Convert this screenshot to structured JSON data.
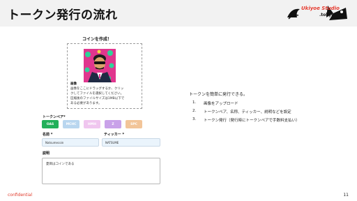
{
  "header": {
    "title": "トークン発行の流れ",
    "logo": {
      "brand": "Ukiyoe Studio",
      "sub": ".tokyo"
    }
  },
  "form": {
    "panel_title": "コインを作成！",
    "image_label": "画像",
    "upload_desc_lines": [
      "画像をここにドラッグするか、クリッ",
      "クしてファイルを選択してください。",
      "圧縮後のファイルサイズは1MB以下で",
      "ある必要があります。"
    ],
    "pair_label": "トークンペア*",
    "pairs": [
      {
        "label": "OAS",
        "color": "#22b05a"
      },
      {
        "label": "MCHC",
        "color": "#b9d6ef"
      },
      {
        "label": "HMH",
        "color": "#f0c6ef"
      },
      {
        "label": "Z",
        "color": "#c9a2e9"
      },
      {
        "label": "SPC",
        "color": "#f2c599"
      }
    ],
    "name_label": "名前 *",
    "name_value": "Natsumecoin",
    "ticker_label": "ティッカー *",
    "ticker_value": "NATSUME",
    "description_label": "説明",
    "description_value": "夏目はコインである"
  },
  "steps": {
    "intro": "トークンを簡単に発行できる。",
    "items": [
      {
        "num": "1.",
        "text": "画像をアップロード"
      },
      {
        "num": "2.",
        "text": "トークンペア、名称、ティッカー、説明などを設定"
      },
      {
        "num": "3.",
        "text": "トークン発行（発行時にトークンペアで手数料支払い）"
      }
    ]
  },
  "footer": {
    "confidential": "confidential",
    "page": "11"
  },
  "colors": {
    "header_bg": "#f2f2f2",
    "accent_red": "#e63a2e"
  }
}
